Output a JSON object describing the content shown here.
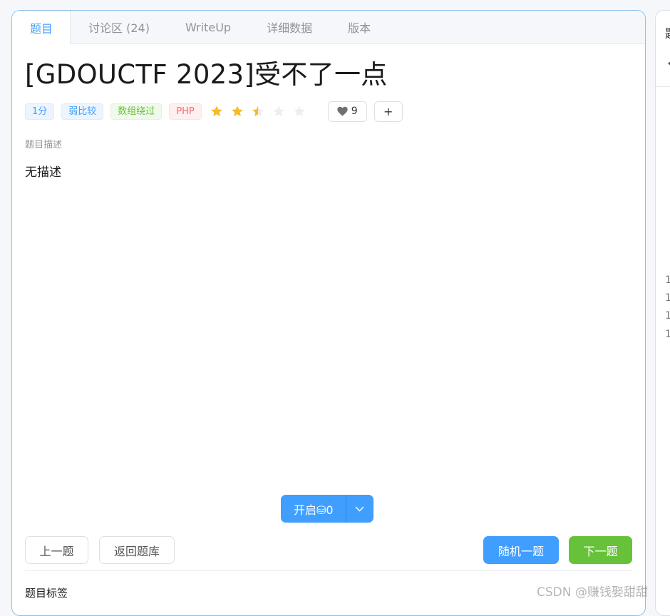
{
  "tabs": [
    {
      "label": "题目",
      "active": true
    },
    {
      "label": "讨论区 (24)",
      "active": false
    },
    {
      "label": "WriteUp",
      "active": false
    },
    {
      "label": "详细数据",
      "active": false
    },
    {
      "label": "版本",
      "active": false
    }
  ],
  "problem": {
    "title": "[GDOUCTF 2023]受不了一点",
    "tags": [
      {
        "label": "1分",
        "color": "#409eff",
        "bg": "#ecf5ff",
        "border": "#d9ecff"
      },
      {
        "label": "弱比较",
        "color": "#409eff",
        "bg": "#ecf5ff",
        "border": "#d9ecff"
      },
      {
        "label": "数组绕过",
        "color": "#67c23a",
        "bg": "#f0f9eb",
        "border": "#e1f3d8"
      },
      {
        "label": "PHP",
        "color": "#f56c6c",
        "bg": "#fef0f0",
        "border": "#fde2e2"
      }
    ],
    "rating": 2.5,
    "rating_max": 5,
    "star_color": "#f7ba2a",
    "star_empty_color": "#eeeeee",
    "likes": "9",
    "add_label": "+",
    "description_label": "题目描述",
    "description": "无描述"
  },
  "actions": {
    "start_label": "开启⛁0",
    "prev_label": "上一题",
    "back_label": "返回题库",
    "random_label": "随机一题",
    "next_label": "下一题"
  },
  "colors": {
    "primary": "#409eff",
    "success": "#67c23a"
  },
  "tags_section": {
    "label": "题目标签"
  },
  "side_panel": {
    "title": "题",
    "line_numbers": [
      "1",
      "1",
      "1",
      "1"
    ]
  },
  "watermark": "CSDN @赚钱娶甜甜"
}
